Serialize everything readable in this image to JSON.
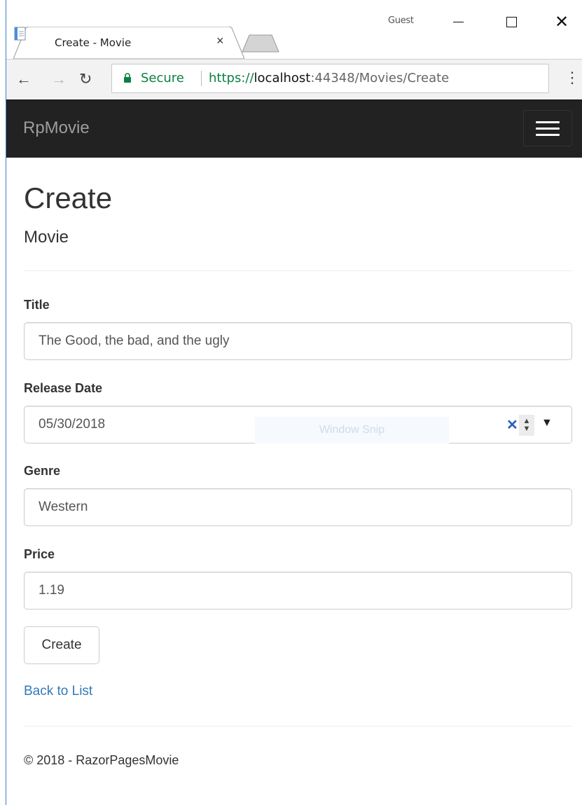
{
  "browser": {
    "profile": "Guest",
    "tab_title": "Create - Movie",
    "tab_close": "×",
    "security_label": "Secure",
    "url_scheme": "https://",
    "url_host": "localhost",
    "url_rest": ":44348/Movies/Create",
    "icons": [
      "back-arrow-icon",
      "forward-arrow-icon",
      "reload-icon",
      "lock-icon",
      "menu-dots-icon",
      "minimize-icon",
      "maximize-icon",
      "close-icon",
      "page-icon"
    ]
  },
  "navbar": {
    "brand": "RpMovie",
    "background": "#222222"
  },
  "page": {
    "heading": "Create",
    "subheading": "Movie"
  },
  "form": {
    "title_label": "Title",
    "title_value": "The Good, the bad, and the ugly",
    "release_date_label": "Release Date",
    "release_date_value": "05/30/2018",
    "genre_label": "Genre",
    "genre_value": "Western",
    "price_label": "Price",
    "price_value": "1.19",
    "submit_label": "Create",
    "overlay_text": "Window Snip"
  },
  "links": {
    "back_to_list": "Back to List",
    "link_color": "#337ab7"
  },
  "footer": {
    "text": "© 2018 - RazorPagesMovie"
  }
}
